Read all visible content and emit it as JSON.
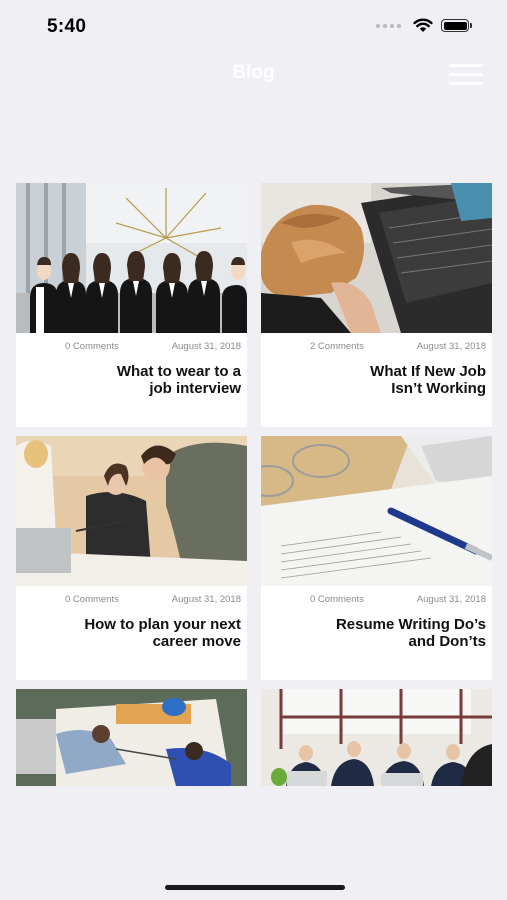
{
  "status_bar": {
    "time": "5:40"
  },
  "nav": {
    "title": "Blog"
  },
  "posts": [
    {
      "comments": "0 Comments",
      "date": "August 31, 2018",
      "title_line1": "What to wear to a",
      "title_line2": "job interview",
      "image": "office-team-photo"
    },
    {
      "comments": "2 Comments",
      "date": "August 31, 2018",
      "title_line1": "What If New Job",
      "title_line2": "Isn’t Working",
      "image": "stressed-woman-laptop-photo"
    },
    {
      "comments": "0 Comments",
      "date": "August 31, 2018",
      "title_line1": "How to plan your next",
      "title_line2": "career move",
      "image": "women-meeting-photo"
    },
    {
      "comments": "0 Comments",
      "date": "August 31, 2018",
      "title_line1": "Resume Writing Do’s",
      "title_line2": "and Don’ts",
      "image": "resume-glasses-pen-photo"
    },
    {
      "image": "construction-meeting-photo"
    },
    {
      "image": "office-team-laptops-photo"
    }
  ],
  "colors": {
    "background": "#efeff4",
    "card": "#ffffff"
  }
}
